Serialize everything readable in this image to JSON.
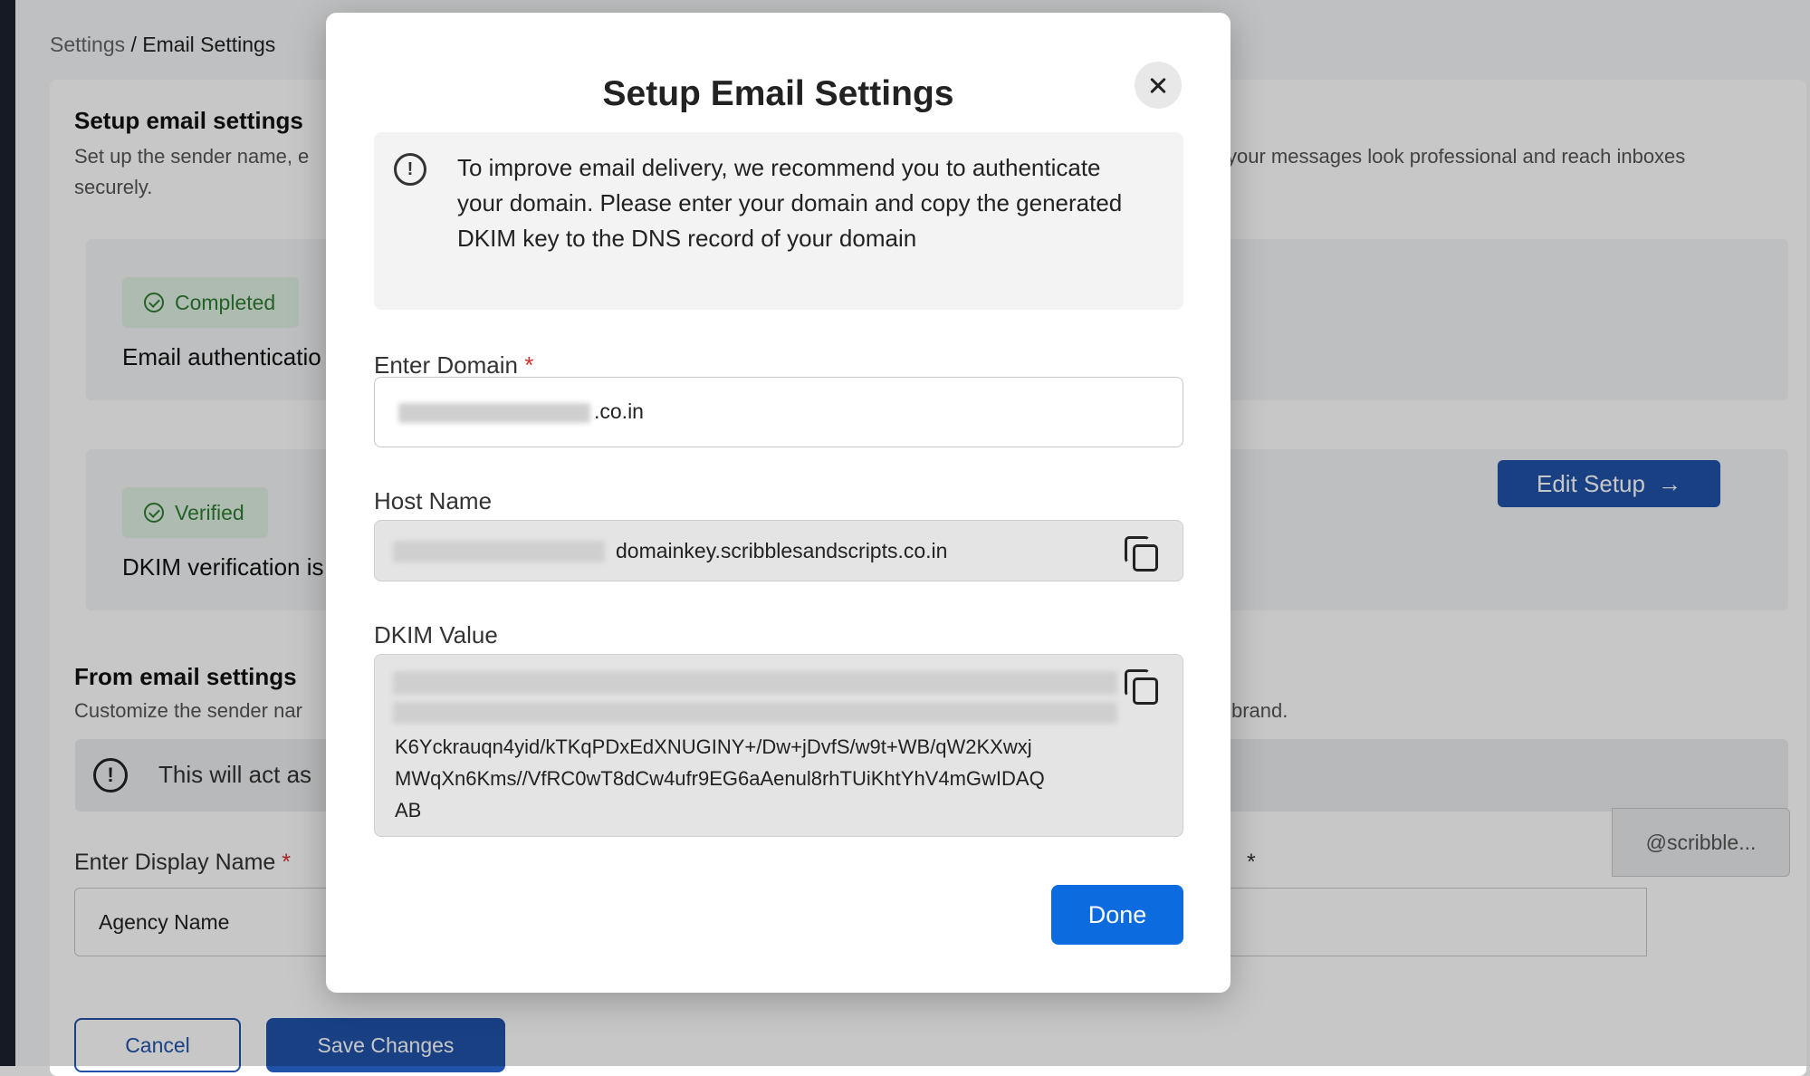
{
  "breadcrumb": {
    "parent": "Settings",
    "separator": " / ",
    "current": "Email Settings"
  },
  "background": {
    "setup_title": "Setup email settings",
    "setup_desc_left": "Set up the sender name, e",
    "setup_desc_left_line2": "securely.",
    "setup_desc_right": "your messages look professional and reach inboxes",
    "status1": {
      "badge": "Completed",
      "text": "Email authenticatio"
    },
    "status2": {
      "badge": "Verified",
      "text": "DKIM verification is"
    },
    "edit_setup_label": "Edit Setup",
    "from_title": "From email settings",
    "from_desc_left": "Customize the sender nar",
    "from_desc_right": "brand.",
    "note_text": "This will act as",
    "display_name_label": "Enter Display Name",
    "display_name_value": "Agency Name",
    "email_suffix": "@scribble...",
    "cancel_label": "Cancel",
    "save_label": "Save Changes",
    "required_marker": "*"
  },
  "modal": {
    "title": "Setup Email Settings",
    "info_text": "To improve email delivery, we recommend you to authenticate your domain. Please enter your domain and copy the generated DKIM key to the DNS record of your domain",
    "domain_label": "Enter Domain",
    "domain_value": ".co.in",
    "host_label": "Host Name",
    "host_value": "domainkey.scribblesandscripts.co.in",
    "dkim_label": "DKIM Value",
    "dkim_line1": "K6Yckrauqn4yid/kTKqPDxEdXNUGINY+/Dw+jDvfS/w9t+WB/qW2KXwxj",
    "dkim_line2": "MWqXn6Kms//VfRC0wT8dCw4ufr9EG6aAenul8rhTUiKhtYhV4mGwIDAQ",
    "dkim_line3": "AB",
    "done_label": "Done",
    "required_marker": "*"
  }
}
